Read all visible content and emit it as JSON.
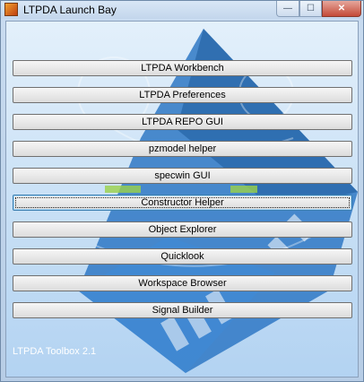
{
  "window": {
    "title": "LTPDA Launch Bay",
    "app_icon": "matlab-icon",
    "controls": {
      "minimize": "—",
      "maximize": "☐",
      "close": "✕"
    }
  },
  "background": {
    "logo_icon": "ltpda-diamond-logo",
    "colors": {
      "logo_blue": "#2f78c4",
      "logo_dark": "#1f5e9e"
    }
  },
  "buttons": [
    {
      "label": "LTPDA Workbench"
    },
    {
      "label": "LTPDA Preferences"
    },
    {
      "label": "LTPDA REPO GUI"
    },
    {
      "label": "pzmodel helper"
    },
    {
      "label": "specwin GUI"
    },
    {
      "label": "Constructor Helper"
    },
    {
      "label": "Object Explorer"
    },
    {
      "label": "Quicklook"
    },
    {
      "label": "Workspace Browser"
    },
    {
      "label": "Signal Builder"
    }
  ],
  "focused_button": "Constructor Helper",
  "footer": {
    "version": "LTPDA Toolbox 2.1"
  }
}
